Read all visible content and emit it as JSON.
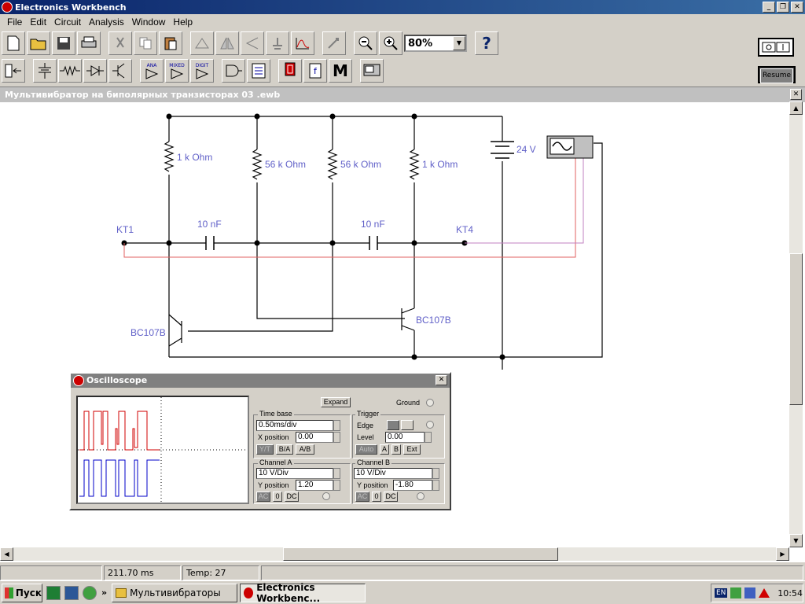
{
  "app": {
    "title": "Electronics Workbench"
  },
  "menu": [
    "File",
    "Edit",
    "Circuit",
    "Analysis",
    "Window",
    "Help"
  ],
  "zoom": {
    "value": "80%"
  },
  "help_label": "?",
  "parts": {
    "ana": "ANA",
    "mixed": "MIXED",
    "digit": "DIGIT",
    "m_label": "M",
    "f_label": "f"
  },
  "resume": {
    "label": "Resume"
  },
  "document": {
    "title": "Мультивибратор на биполярных транзисторах  03 .ewb"
  },
  "circuit": {
    "labels": {
      "r1": "1 k Ohm",
      "r2": "56 k Ohm",
      "r3": "56 k Ohm",
      "r4": "1 k Ohm",
      "c1": "10 nF",
      "c2": "10 nF",
      "battery": "24 V",
      "kt1": "KT1",
      "kt4": "KT4",
      "q1": "BC107B",
      "q2": "BC107B"
    }
  },
  "oscilloscope": {
    "title": "Oscilloscope",
    "expand": "Expand",
    "ground": "Ground",
    "time_base": {
      "label": "Time base",
      "value": "0.50ms/div",
      "xpos_label": "X position",
      "xpos": "0.00",
      "modes": [
        "Y/T",
        "B/A",
        "A/B"
      ]
    },
    "trigger": {
      "label": "Trigger",
      "edge_label": "Edge",
      "level_label": "Level",
      "level": "0.00",
      "sources": [
        "Auto",
        "A",
        "B",
        "Ext"
      ]
    },
    "channel_a": {
      "label": "Channel A",
      "scale": "10  V/Div",
      "ypos_label": "Y position",
      "ypos": "1.20",
      "coupling": [
        "AC",
        "0",
        "DC"
      ]
    },
    "channel_b": {
      "label": "Channel B",
      "scale": "10  V/Div",
      "ypos_label": "Y position",
      "ypos": "-1.80",
      "coupling": [
        "AC",
        "0",
        "DC"
      ]
    },
    "colors": {
      "channel_a": "#d00000",
      "channel_b": "#0000c8"
    }
  },
  "status": {
    "time": "211.70 ms",
    "temp": "Temp:  27"
  },
  "taskbar": {
    "start": "Пуск",
    "tasks": [
      "Мультивибраторы",
      "Electronics Workbenc..."
    ],
    "lang": "EN",
    "clock": "10:54",
    "chevron": "»"
  }
}
